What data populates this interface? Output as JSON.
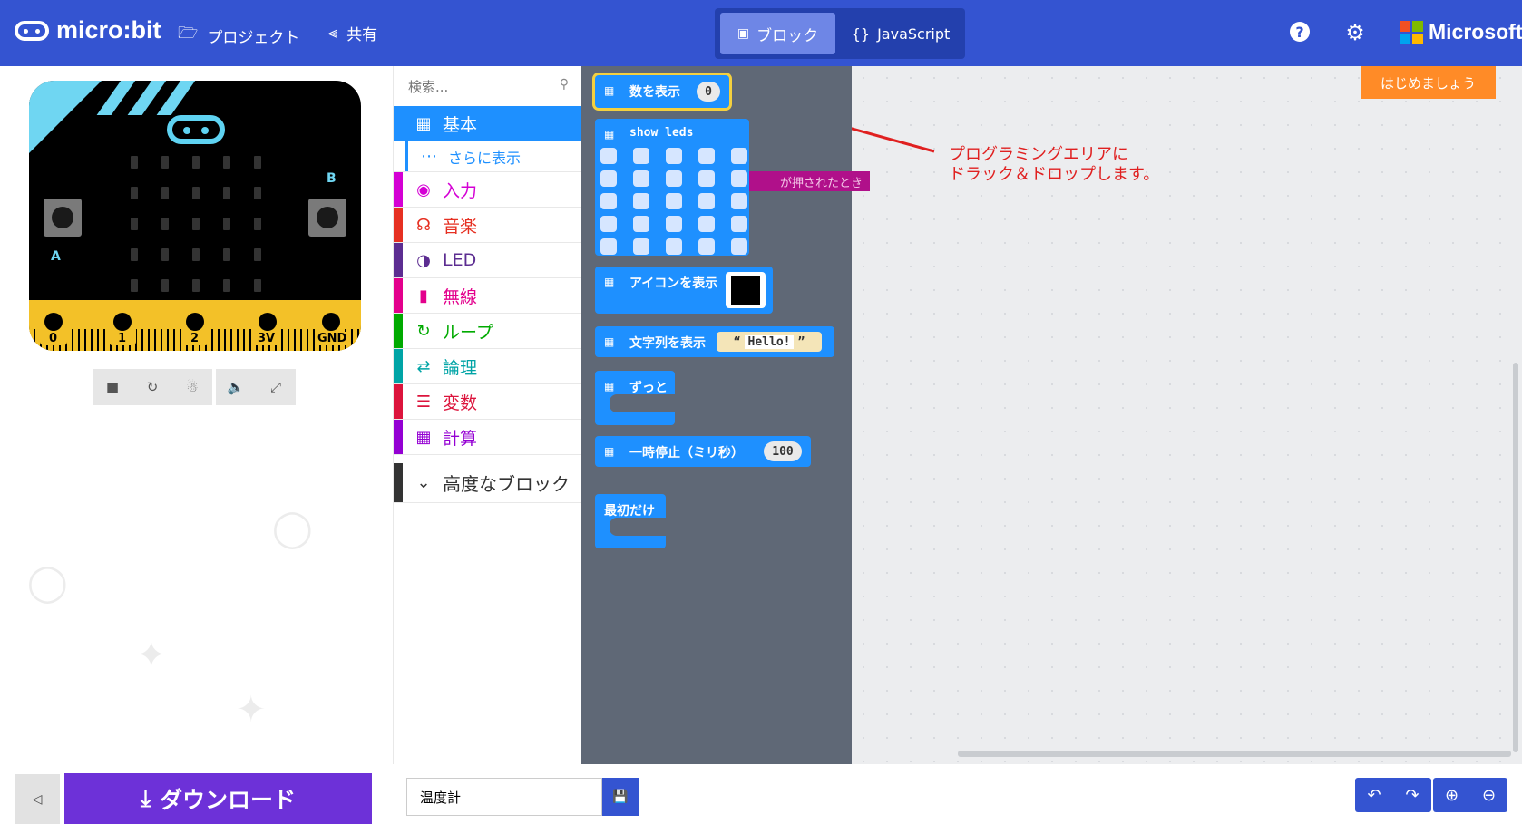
{
  "header": {
    "logo": "micro:bit",
    "nav_projects": "プロジェクト",
    "nav_share": "共有",
    "tab_blocks": "ブロック",
    "tab_js": "JavaScript",
    "js_icon": "{}",
    "microsoft": "Microsoft",
    "ms_colors": [
      "#f25022",
      "#7fba00",
      "#00a4ef",
      "#ffb900"
    ]
  },
  "sim": {
    "pins": [
      "0",
      "1",
      "2",
      "3V",
      "GND"
    ],
    "btn_a": "A",
    "btn_b": "B"
  },
  "toolbox": {
    "search_placeholder": "検索...",
    "categories": [
      {
        "label": "基本",
        "color": "#1e90ff",
        "icon": "grid-icon"
      },
      {
        "label": "さらに表示",
        "color": "#1e90ff",
        "icon": "more-icon"
      },
      {
        "label": "入力",
        "color": "#d400d4",
        "icon": "target-icon"
      },
      {
        "label": "音楽",
        "color": "#e63022",
        "icon": "headphones-icon"
      },
      {
        "label": "LED",
        "color": "#5c2d91",
        "icon": "toggle-icon"
      },
      {
        "label": "無線",
        "color": "#e3008c",
        "icon": "signal-icon"
      },
      {
        "label": "ループ",
        "color": "#00aa00",
        "icon": "loop-icon"
      },
      {
        "label": "論理",
        "color": "#00a4a6",
        "icon": "shuffle-icon"
      },
      {
        "label": "変数",
        "color": "#dc143c",
        "icon": "variable-icon"
      },
      {
        "label": "計算",
        "color": "#9400d3",
        "icon": "calculator-icon"
      }
    ],
    "advanced": "高度なブロック"
  },
  "blocks": {
    "show_number": "数を表示",
    "show_number_value": "0",
    "show_leds": "show leds",
    "show_icon": "アイコンを表示",
    "show_string": "文字列を表示",
    "show_string_value": "Hello!",
    "forever": "ずっと",
    "pause": "一時停止（ミリ秒）",
    "pause_value": "100",
    "on_start": "最初だけ",
    "ghost": "が押されたとき"
  },
  "workspace": {
    "start_button": "はじめましょう",
    "annotation_line1": "プログラミングエリアに",
    "annotation_line2": "ドラック＆ドロップします。"
  },
  "footer": {
    "download": "ダウンロード",
    "project_name": "温度計"
  }
}
